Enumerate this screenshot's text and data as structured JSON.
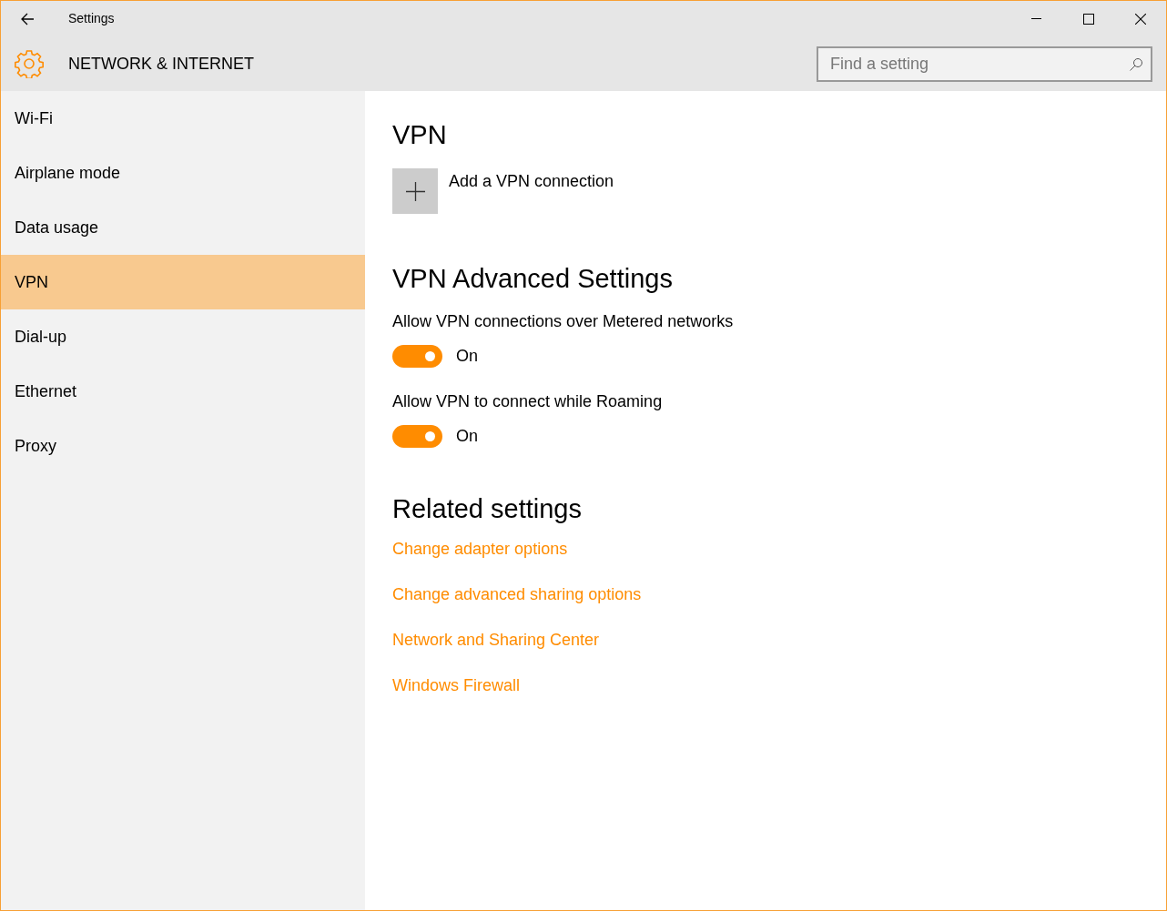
{
  "window": {
    "title": "Settings"
  },
  "header": {
    "title": "NETWORK & INTERNET",
    "search": {
      "placeholder": "Find a setting"
    }
  },
  "sidebar": {
    "items": [
      {
        "label": "Wi-Fi",
        "selected": false
      },
      {
        "label": "Airplane mode",
        "selected": false
      },
      {
        "label": "Data usage",
        "selected": false
      },
      {
        "label": "VPN",
        "selected": true
      },
      {
        "label": "Dial-up",
        "selected": false
      },
      {
        "label": "Ethernet",
        "selected": false
      },
      {
        "label": "Proxy",
        "selected": false
      }
    ]
  },
  "content": {
    "title": "VPN",
    "add_button": {
      "label": "Add a VPN connection"
    },
    "advanced": {
      "title": "VPN Advanced Settings",
      "toggles": [
        {
          "label": "Allow VPN connections over Metered networks",
          "on": true,
          "state_text": "On"
        },
        {
          "label": "Allow VPN to connect while Roaming",
          "on": true,
          "state_text": "On"
        }
      ]
    },
    "related": {
      "title": "Related settings",
      "links": [
        "Change adapter options",
        "Change advanced sharing options",
        "Network and Sharing Center",
        "Windows Firewall"
      ]
    }
  }
}
